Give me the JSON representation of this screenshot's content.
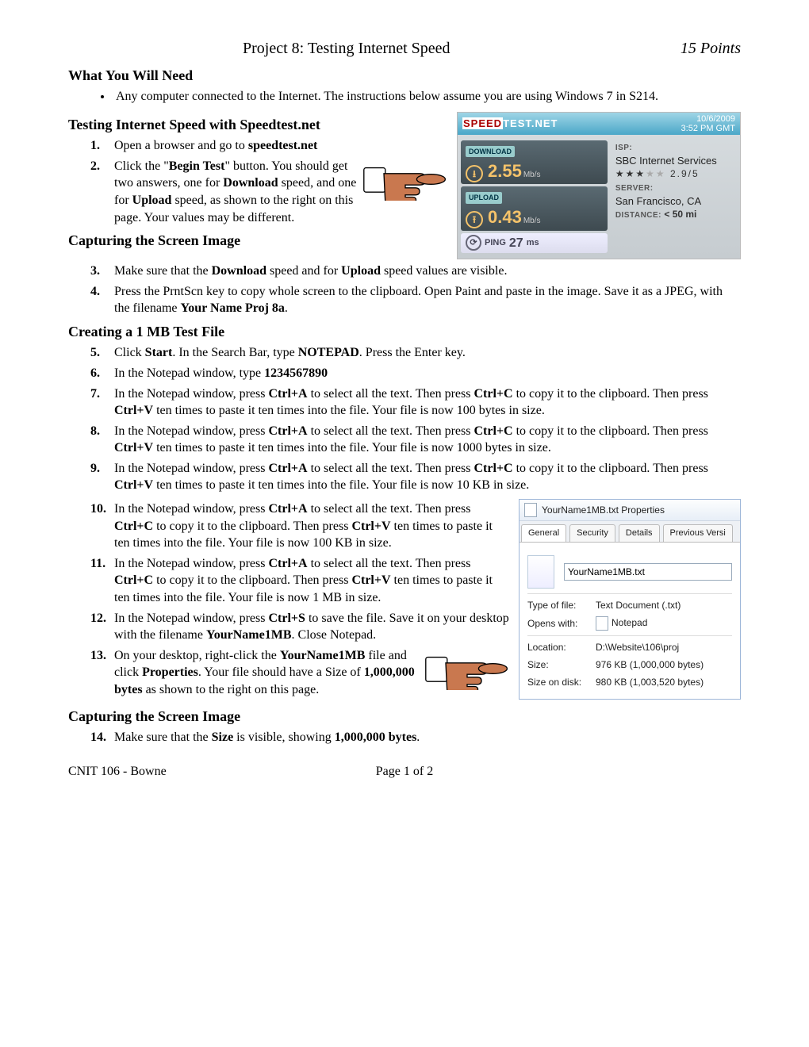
{
  "header": {
    "title": "Project 8: Testing Internet Speed",
    "points": "15 Points"
  },
  "h_need": "What You Will Need",
  "need_bullet": "Any computer connected to the Internet.  The instructions below assume you are using Windows 7 in S214.",
  "h_testing": "Testing Internet Speed with Speedtest.net",
  "steps": {
    "s1": {
      "num": "1.",
      "pre": "Open a browser and go to ",
      "b1": "speedtest.net"
    },
    "s2": {
      "num": "2.",
      "t1": "Click the \"",
      "b1": "Begin Test",
      "t2": "\" button.  You should get two answers, one for ",
      "b2": "Download",
      "t3": " speed, and one for ",
      "b3": "Upload",
      "t4": " speed, as shown to the right on this page.  Your values may be different."
    },
    "s3": {
      "num": "3.",
      "t1": "Make sure that the ",
      "b1": "Download",
      "t2": " speed and for ",
      "b2": "Upload",
      "t3": " speed values are visible."
    },
    "s4": {
      "num": "4.",
      "t1": "Press the PrntScn key to copy whole screen to the clipboard.  Open Paint and paste in the image.  Save it as a JPEG, with the filename ",
      "b1": "Your Name Proj 8a",
      "t2": "."
    },
    "s5": {
      "num": "5.",
      "t1": "Click ",
      "b1": "Start",
      "t2": ".  In the Search Bar, type ",
      "b2": "NOTEPAD",
      "t3": ".  Press the Enter key."
    },
    "s6": {
      "num": "6.",
      "t1": "In the Notepad window, type ",
      "b1": "1234567890"
    },
    "s7": {
      "num": "7.",
      "t1": "In the Notepad window, press ",
      "b1": "Ctrl+A",
      "t2": " to select all the text.  Then press ",
      "b2": "Ctrl+C",
      "t3": " to copy it to the clipboard.  Then press ",
      "b3": "Ctrl+V",
      "t4": " ten times to paste it ten times into the file.  Your file is now 100 bytes in size."
    },
    "s8": {
      "num": "8.",
      "t1": "In the Notepad window, press ",
      "b1": "Ctrl+A",
      "t2": " to select all the text.  Then press ",
      "b2": "Ctrl+C",
      "t3": " to copy it to the clipboard.  Then press ",
      "b3": "Ctrl+V",
      "t4": " ten times to paste it ten times into the file.  Your file is now 1000 bytes in size."
    },
    "s9": {
      "num": "9.",
      "t1": "In the Notepad window, press ",
      "b1": "Ctrl+A",
      "t2": " to select all the text.  Then press ",
      "b2": "Ctrl+C",
      "t3": " to copy it to the clipboard.  Then press ",
      "b3": "Ctrl+V",
      "t4": " ten times to paste it ten times into the file.  Your file is now 10 KB in size."
    },
    "s10": {
      "num": "10.",
      "t1": "In the Notepad window, press ",
      "b1": "Ctrl+A",
      "t2": " to select all the text.  Then press ",
      "b2": "Ctrl+C",
      "t3": " to copy it to the clipboard.  Then press ",
      "b3": "Ctrl+V",
      "t4": " ten times to paste it ten times into the file.  Your file is now 100 KB in size."
    },
    "s11": {
      "num": "11.",
      "t1": "In the Notepad window, press ",
      "b1": "Ctrl+A",
      "t2": " to select all the text.  Then press ",
      "b2": "Ctrl+C",
      "t3": " to copy it to the clipboard.  Then press ",
      "b3": "Ctrl+V",
      "t4": " ten times to paste it ten times into the file.  Your file is now 1 MB  in size."
    },
    "s12": {
      "num": "12.",
      "t1": "In the Notepad window, press ",
      "b1": "Ctrl+S",
      "t2": " to save the file. Save it on your desktop with the filename ",
      "b2": "YourName1MB",
      "t3": ".  Close Notepad."
    },
    "s13": {
      "num": "13.",
      "t1": "On your desktop, right-click the ",
      "b1": "YourName1MB",
      "t2": " file and click ",
      "b2": "Properties",
      "t3": ".  Your file should have a Size of ",
      "b3": "1,000,000 bytes",
      "t4": " as shown to the right on this page."
    },
    "s14": {
      "num": "14.",
      "t1": "Make sure that the ",
      "b1": "Size",
      "t2": " is visible, showing ",
      "b2": "1,000,000 bytes",
      "t3": "."
    }
  },
  "h_cap1": "Capturing the Screen Image",
  "h_create": "Creating a 1 MB Test File",
  "h_cap2": "Capturing the Screen Image",
  "speedtest": {
    "logo1": "SPEED",
    "logo2": "TEST.NET",
    "date": "10/6/2009",
    "time": "3:52 PM GMT",
    "dl_lbl": "DOWNLOAD",
    "dl_val": "2.55",
    "dl_unit": "Mb/s",
    "ul_lbl": "UPLOAD",
    "ul_val": "0.43",
    "ul_unit": "Mb/s",
    "ping_lbl": "PING",
    "ping_val": "27",
    "ping_unit": "ms",
    "isp_lbl": "ISP:",
    "isp_val": "SBC Internet Services",
    "rating": "★★★",
    "rating_dim": "★★",
    "rating_num": " 2.9/5",
    "srv_lbl": "SERVER:",
    "srv_val": "San Francisco, CA",
    "dist_lbl": "DISTANCE:",
    "dist_val": "< 50 mi"
  },
  "props": {
    "title": "YourName1MB.txt Properties",
    "tabs": {
      "t1": "General",
      "t2": "Security",
      "t3": "Details",
      "t4": "Previous Versi"
    },
    "fname": "YourName1MB.txt",
    "k_type": "Type of file:",
    "v_type": "Text Document (.txt)",
    "k_opens": "Opens with:",
    "v_opens": "Notepad",
    "k_loc": "Location:",
    "v_loc": "D:\\Website\\106\\proj",
    "k_size": "Size:",
    "v_size": "976 KB (1,000,000 bytes)",
    "k_sod": "Size on disk:",
    "v_sod": "980 KB (1,003,520 bytes)"
  },
  "footer": {
    "left": "CNIT 106 - Bowne",
    "mid": "Page 1 of 2"
  }
}
